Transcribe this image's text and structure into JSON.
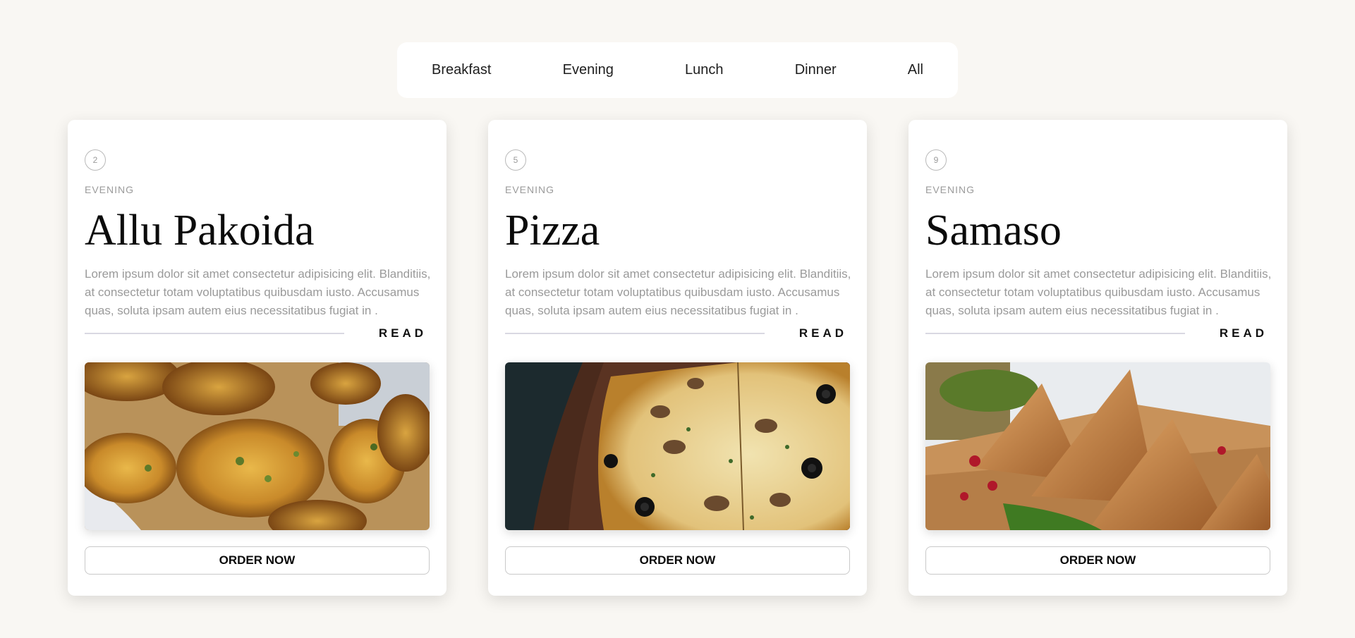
{
  "filters": [
    "Breakfast",
    "Evening",
    "Lunch",
    "Dinner",
    "All"
  ],
  "cards": [
    {
      "number": "2",
      "category": "EVENING",
      "title": "Allu Pakoida",
      "description": "Lorem ipsum dolor sit amet consectetur adipisicing elit. Blanditiis, at consectetur totam voluptatibus quibusdam iusto. Accusamus quas, soluta ipsam autem eius necessitatibus fugiat in .",
      "read_label": "READ",
      "order_label": "ORDER NOW",
      "image": "pakora-photo"
    },
    {
      "number": "5",
      "category": "EVENING",
      "title": "Pizza",
      "description": "Lorem ipsum dolor sit amet consectetur adipisicing elit. Blanditiis, at consectetur totam voluptatibus quibusdam iusto. Accusamus quas, soluta ipsam autem eius necessitatibus fugiat in .",
      "read_label": "READ",
      "order_label": "ORDER NOW",
      "image": "pizza-photo"
    },
    {
      "number": "9",
      "category": "EVENING",
      "title": "Samaso",
      "description": "Lorem ipsum dolor sit amet consectetur adipisicing elit. Blanditiis, at consectetur totam voluptatibus quibusdam iusto. Accusamus quas, soluta ipsam autem eius necessitatibus fugiat in .",
      "read_label": "READ",
      "order_label": "ORDER NOW",
      "image": "samosa-photo"
    }
  ]
}
